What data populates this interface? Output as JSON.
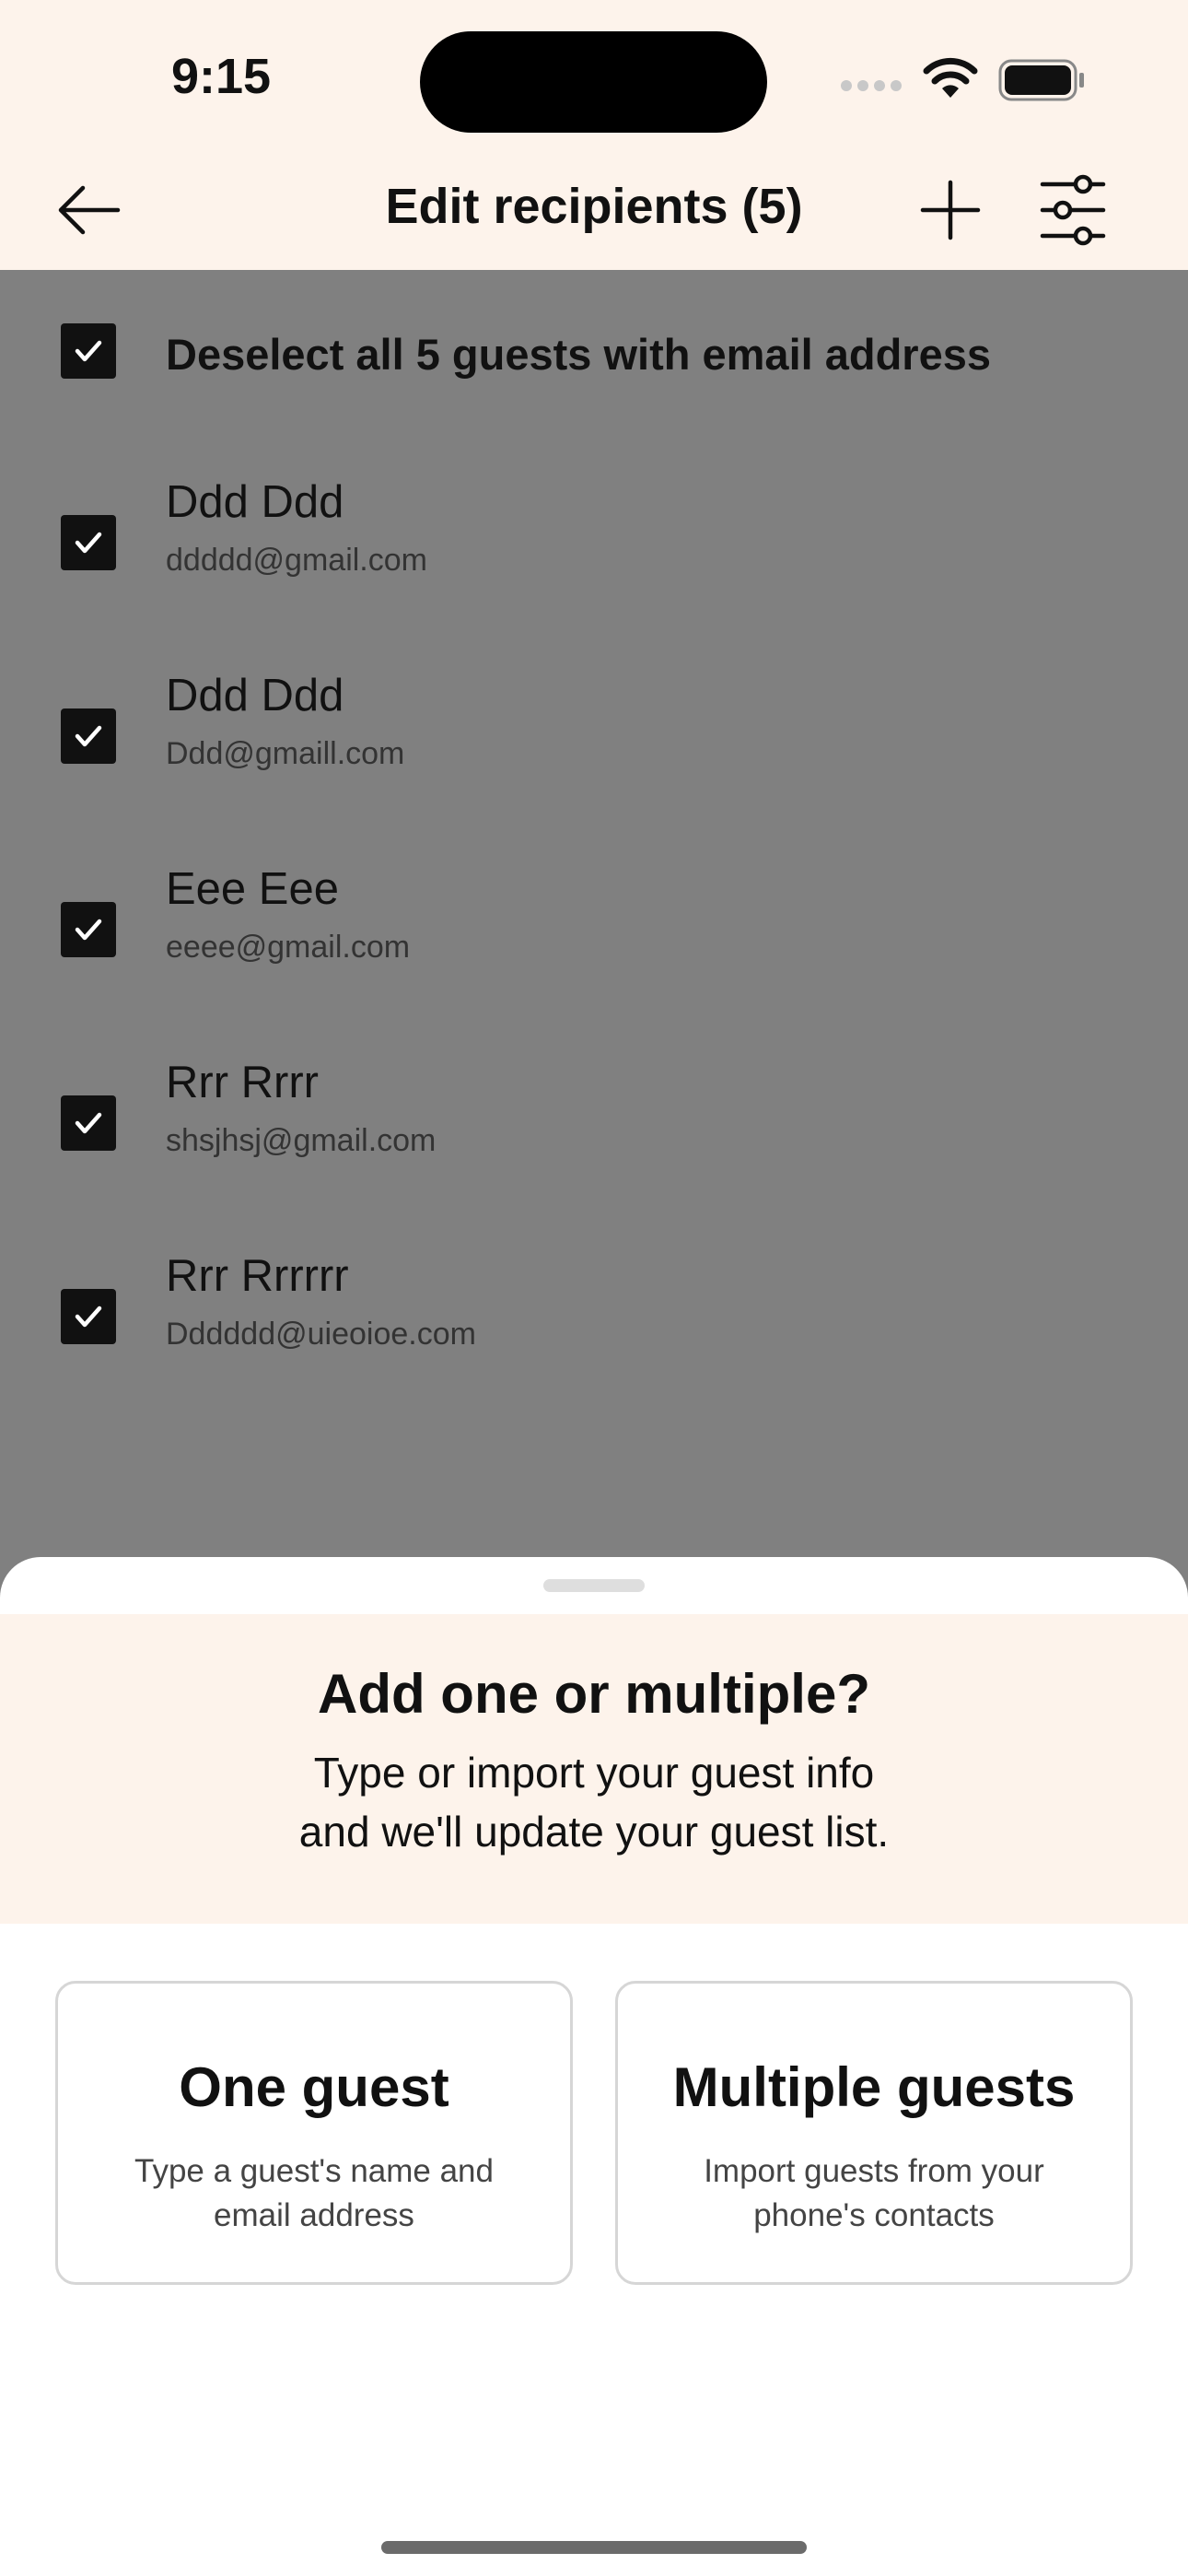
{
  "status_bar": {
    "time": "9:15"
  },
  "header": {
    "title": "Edit recipients (5)"
  },
  "list": {
    "select_all_label": "Deselect all 5 guests with email address",
    "recipients": [
      {
        "name": "Ddd Ddd",
        "email": "ddddd@gmail.com",
        "checked": true
      },
      {
        "name": "Ddd Ddd",
        "email": "Ddd@gmaill.com",
        "checked": true
      },
      {
        "name": "Eee Eee",
        "email": "eeee@gmail.com",
        "checked": true
      },
      {
        "name": "Rrr Rrrr",
        "email": "shsjhsj@gmail.com",
        "checked": true
      },
      {
        "name": "Rrr Rrrrrr",
        "email": "Dddddd@uieoioe.com",
        "checked": true
      }
    ]
  },
  "sheet": {
    "title": "Add one or multiple?",
    "subtitle_line1": "Type or import your guest info",
    "subtitle_line2": "and we'll update your guest list.",
    "options": [
      {
        "title": "One guest",
        "desc_line1": "Type a guest's name and",
        "desc_line2": "email address"
      },
      {
        "title": "Multiple guests",
        "desc_line1": "Import guests from your",
        "desc_line2": "phone's contacts"
      }
    ]
  },
  "colors": {
    "header_bg": "#FDF3EB",
    "overlay_bg": "#808080",
    "checkbox": "#111111",
    "sheet_bg": "#FFFFFF"
  }
}
